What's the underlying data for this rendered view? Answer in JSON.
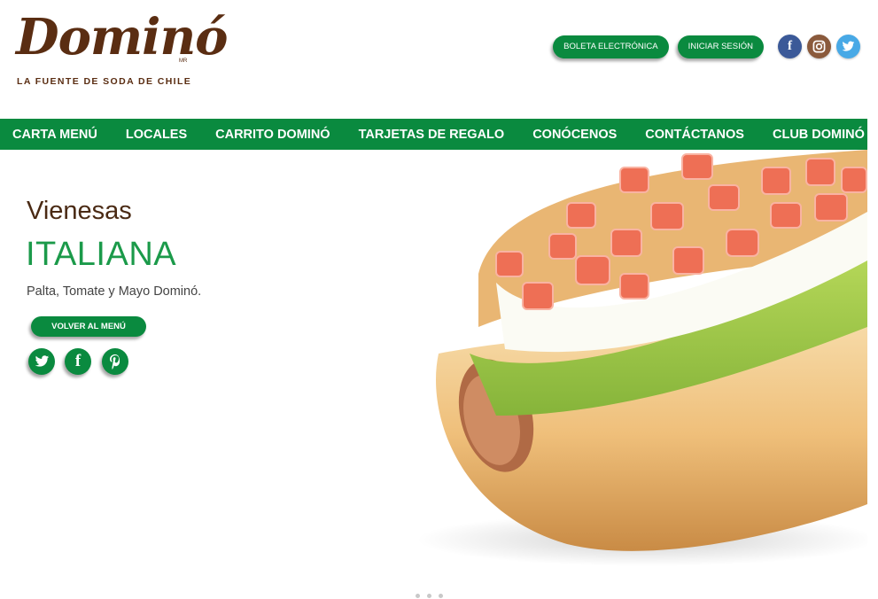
{
  "brand": {
    "name": "Dominó",
    "mark": "MR",
    "tagline": "LA FUENTE DE SODA DE CHILE"
  },
  "header": {
    "boleta_label": "BOLETA ELECTRÓNICA",
    "login_label": "INICIAR SESIÓN",
    "social_icons": [
      "facebook-icon",
      "instagram-icon",
      "twitter-icon"
    ]
  },
  "nav": {
    "items": [
      {
        "label": "CARTA MENÚ"
      },
      {
        "label": "LOCALES"
      },
      {
        "label": "CARRITO DOMINÓ"
      },
      {
        "label": "TARJETAS DE REGALO"
      },
      {
        "label": "CONÓCENOS"
      },
      {
        "label": "CONTÁCTANOS"
      },
      {
        "label": "CLUB DOMINÓ"
      }
    ]
  },
  "product": {
    "category": "Vienesas",
    "name": "ITALIANA",
    "description": "Palta, Tomate y Mayo Dominó.",
    "back_label": "VOLVER AL MENÚ",
    "share_icons": [
      "twitter-icon",
      "facebook-icon",
      "pinterest-icon"
    ]
  },
  "colors": {
    "brand_green": "#0a8a3f",
    "title_green": "#1b9a4a",
    "brand_brown": "#5a2d12",
    "facebook": "#3b5998",
    "instagram": "#8a5a3c",
    "twitter": "#48a9e6"
  }
}
